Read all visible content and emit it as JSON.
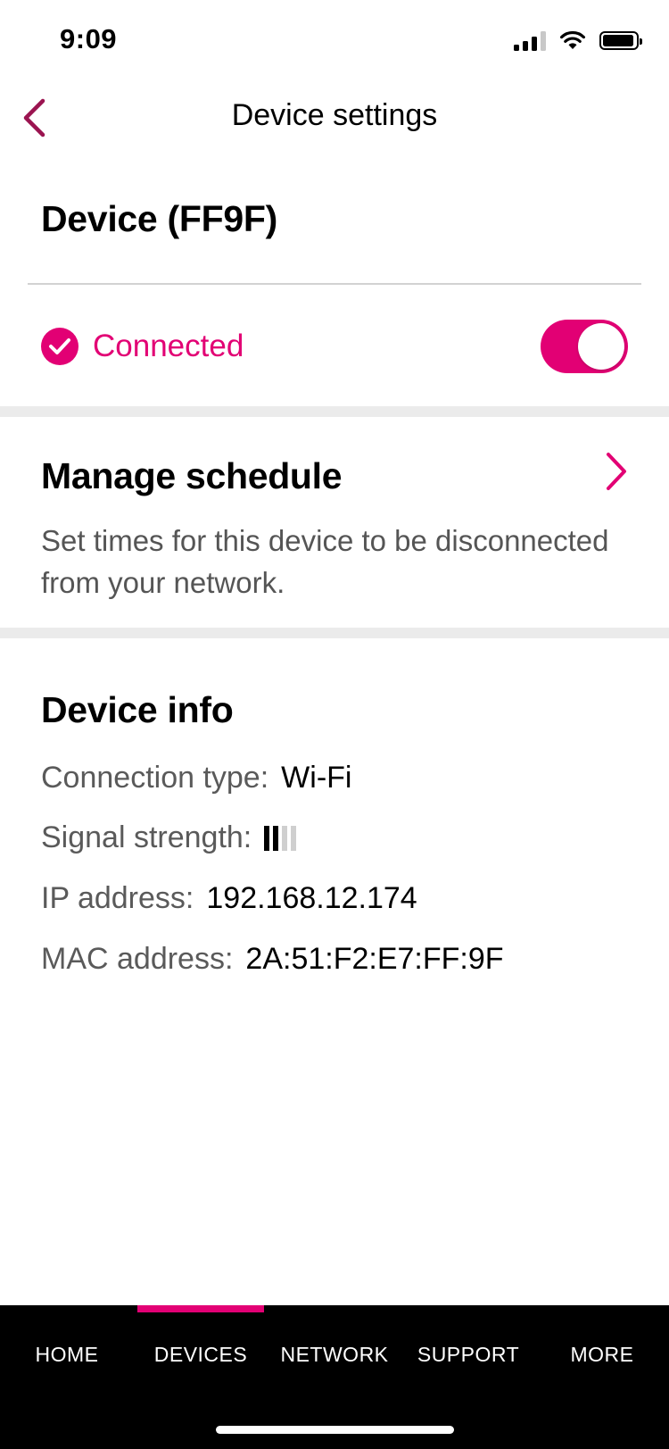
{
  "status_bar": {
    "time": "9:09"
  },
  "header": {
    "title": "Device settings"
  },
  "device": {
    "name": "Device (FF9F)",
    "connection_status": "Connected",
    "connected_toggle_on": true
  },
  "schedule": {
    "title": "Manage schedule",
    "description": "Set times for this device to be disconnected from your network."
  },
  "device_info": {
    "title": "Device info",
    "connection_type_label": "Connection type:",
    "connection_type_value": "Wi-Fi",
    "signal_strength_label": "Signal strength:",
    "signal_strength_bars": 2,
    "signal_strength_max": 4,
    "ip_label": "IP address:",
    "ip_value": "192.168.12.174",
    "mac_label": "MAC address:",
    "mac_value": "2A:51:F2:E7:FF:9F"
  },
  "tabs": [
    {
      "label": "HOME",
      "active": false
    },
    {
      "label": "DEVICES",
      "active": true
    },
    {
      "label": "NETWORK",
      "active": false
    },
    {
      "label": "SUPPORT",
      "active": false
    },
    {
      "label": "MORE",
      "active": false
    }
  ],
  "colors": {
    "accent": "#e20074",
    "nav_background": "#000000"
  }
}
